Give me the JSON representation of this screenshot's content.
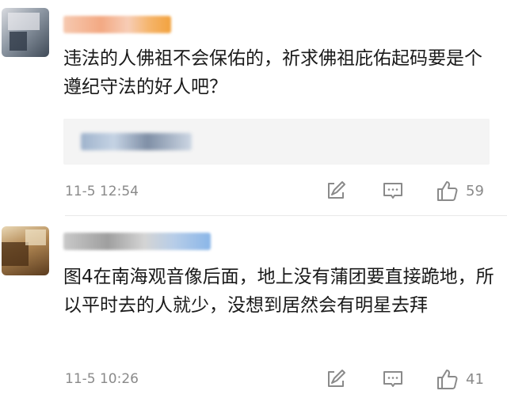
{
  "comments": [
    {
      "username": "",
      "text": "违法的人佛祖不会保佑的，祈求佛祖庇佑起码要是个遵纪守法的好人吧？",
      "quote": "",
      "time": "11-5 12:54",
      "likes": "59",
      "icons": [
        "avatar",
        "share-icon",
        "comment-icon",
        "like-icon"
      ]
    },
    {
      "username": "",
      "text": "图4在南海观音像后面，地上没有蒲团要直接跪地，所以平时去的人就少，没想到居然会有明星去拜",
      "time": "11-5 10:26",
      "likes": "41",
      "icons": [
        "avatar",
        "share-icon",
        "comment-icon",
        "like-icon"
      ]
    }
  ],
  "colors": {
    "text": "#1a1a1a",
    "meta": "#8a8a8a",
    "quote_bg": "#f4f4f4",
    "divider": "#e8e8e8"
  }
}
